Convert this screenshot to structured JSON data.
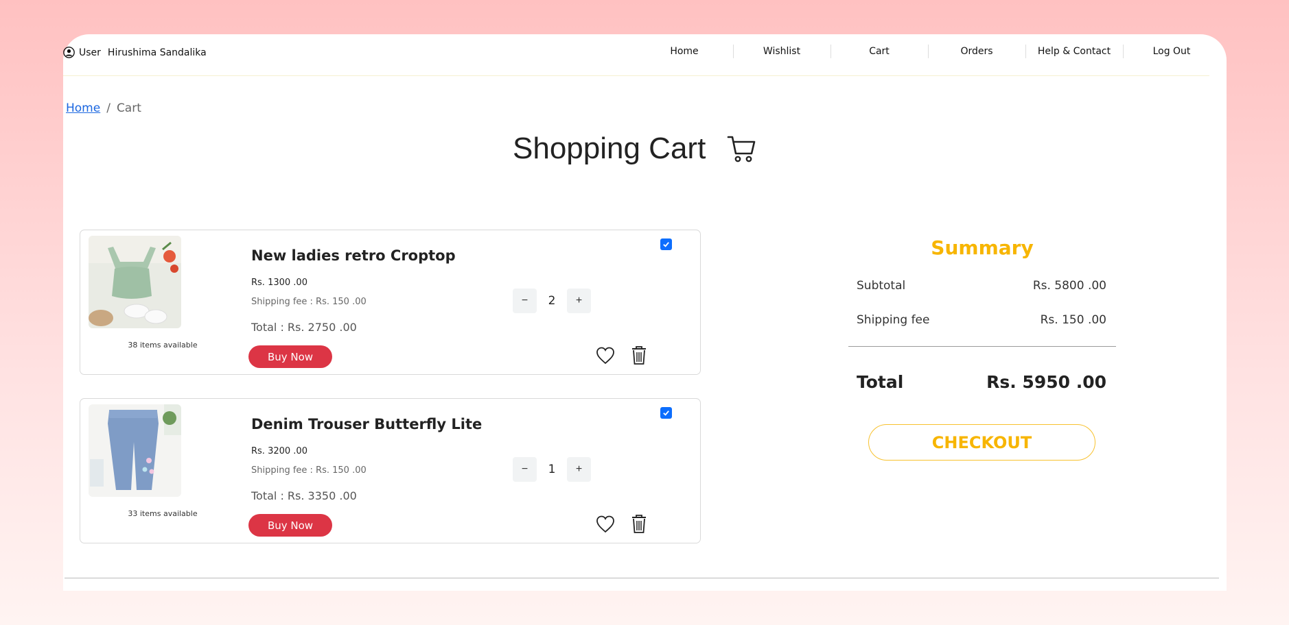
{
  "header": {
    "user_label": "User",
    "user_name": "Hirushima Sandalika",
    "nav": [
      "Home",
      "Wishlist",
      "Cart",
      "Orders",
      "Help & Contact",
      "Log Out"
    ]
  },
  "breadcrumb": {
    "home": "Home",
    "sep": "/",
    "current": "Cart"
  },
  "page": {
    "title": "Shopping Cart",
    "icon": "cart-icon"
  },
  "items": [
    {
      "name": "New ladies retro Croptop",
      "price": "Rs. 1300 .00",
      "shipping": "Shipping fee : Rs. 150 .00",
      "total": "Total : Rs. 2750 .00",
      "available": "38 items available",
      "quantity": "2",
      "selected": true,
      "buy_label": "Buy Now"
    },
    {
      "name": "Denim Trouser Butterfly Lite",
      "price": "Rs. 3200 .00",
      "shipping": "Shipping fee : Rs. 150 .00",
      "total": "Total : Rs. 3350 .00",
      "available": "33 items available",
      "quantity": "1",
      "selected": true,
      "buy_label": "Buy Now"
    }
  ],
  "qty_controls": {
    "minus": "−",
    "plus": "+"
  },
  "summary": {
    "title": "Summary",
    "subtotal_label": "Subtotal",
    "subtotal_value": "Rs. 5800 .00",
    "shipping_label": "Shipping fee",
    "shipping_value": "Rs. 150 .00",
    "total_label": "Total",
    "total_value": "Rs. 5950 .00",
    "checkout_label": "CHECKOUT"
  },
  "colors": {
    "accent": "#f7b500",
    "buy_button": "#dc3545",
    "checkbox": "#0d6efd",
    "link": "#1a66e0"
  }
}
